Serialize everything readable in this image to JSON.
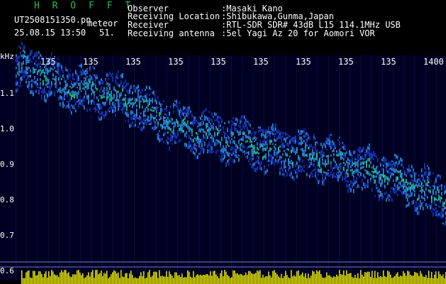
{
  "header": {
    "app_title": "H R O F F T",
    "filename": "UT2508151350.pn",
    "mode": "meteor",
    "datetime": "25.08.15 13:50",
    "frame": "51."
  },
  "info": [
    {
      "label": "Observer",
      "value": ":Masaki Kano"
    },
    {
      "label": "Receiving Location",
      "value": ":Shibukawa,Gunma,Japan"
    },
    {
      "label": "Receiver",
      "value": ":RTL-SDR SDR# 43dB L15 114.1MHz USB"
    },
    {
      "label": "Receiving antenna",
      "value": ":5el Yagi Az 20 for Aomori VOR"
    }
  ],
  "chart_data": {
    "type": "heatmap",
    "y_unit_label": "kHz",
    "y_ticks": [
      "1.1",
      "1.0",
      "0.9",
      "0.8",
      "0.7",
      "0.6"
    ],
    "x_ticks": [
      "135",
      "135",
      "135",
      "135",
      "135",
      "135",
      "135",
      "135",
      "135",
      "1400"
    ],
    "ylim": [
      0.58,
      1.19
    ],
    "trace_freq_khz": [
      1.16,
      1.15,
      1.11,
      1.1,
      1.09,
      1.07,
      1.04,
      1.0,
      0.99,
      0.97,
      0.96,
      0.94,
      0.93,
      0.92,
      0.91,
      0.89,
      0.87,
      0.85,
      0.83,
      0.8
    ],
    "background": "#000022",
    "colors": {
      "low": "#1a3cd6",
      "mid": "#2ea8ff",
      "high": "#22ff88",
      "peak": "#ffff00",
      "grid": "#1c2a7a",
      "baseline": "#6a7bd0"
    }
  }
}
